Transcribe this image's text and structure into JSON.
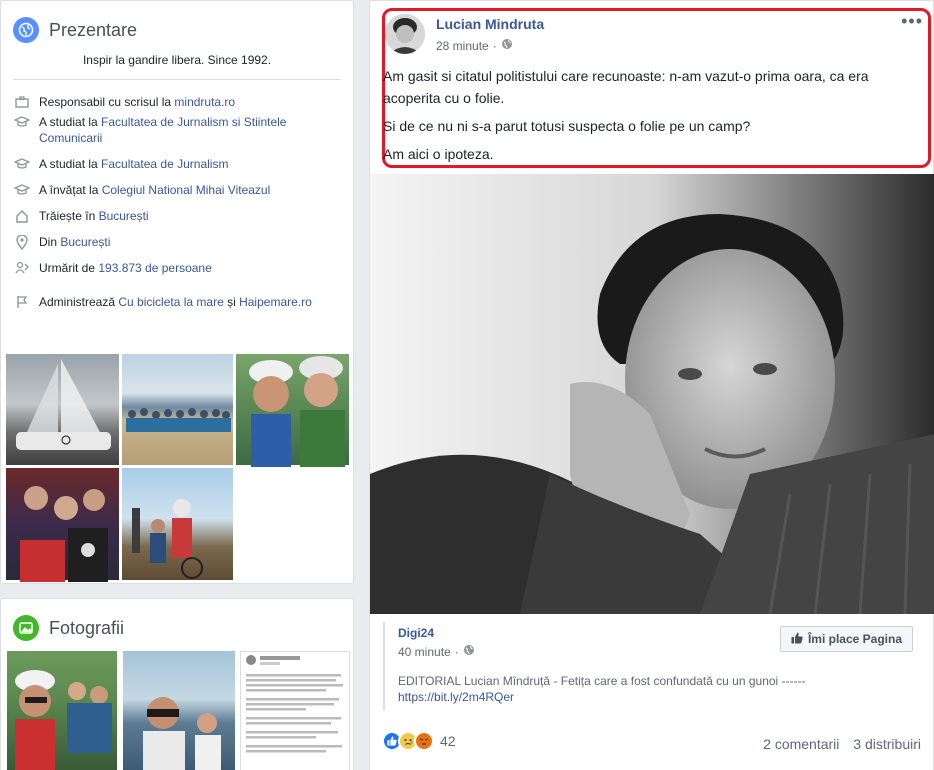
{
  "intro": {
    "title": "Prezentare",
    "bio": "Inspir la gandire libera. Since 1992.",
    "rows": [
      {
        "icon": "briefcase-icon",
        "pre": "Responsabil cu scrisul la ",
        "link": "mindruta.ro",
        "post": ""
      },
      {
        "icon": "graduation-cap-icon",
        "pre": "A studiat la ",
        "link": "Facultatea de Jurnalism si Stiintele Comunicarii",
        "post": ""
      },
      {
        "icon": "graduation-cap-icon",
        "pre": "A studiat la ",
        "link": "Facultatea de Jurnalism",
        "post": ""
      },
      {
        "icon": "graduation-cap-icon",
        "pre": "A învățat la ",
        "link": "Colegiul National Mihai Viteazul",
        "post": ""
      },
      {
        "icon": "home-icon",
        "pre": "Trăiește în ",
        "link": "București",
        "post": ""
      },
      {
        "icon": "location-pin-icon",
        "pre": "Din ",
        "link": "București",
        "post": ""
      },
      {
        "icon": "follow-icon",
        "pre": "Urmărit de ",
        "link": "193.873 de persoane",
        "post": ""
      },
      {
        "icon": "flag-icon",
        "pre": "Administrează ",
        "link": "Cu bicicleta la mare",
        "post": " și ",
        "link2": "Haipemare.ro"
      }
    ]
  },
  "photos_card": {
    "title": "Fotografii"
  },
  "post": {
    "author": "Lucian Mindruta",
    "time": "28 minute",
    "more": "•••",
    "paragraphs": [
      "Am gasit si citatul politistului care recunoaste: n-am vazut-o prima oara, ca era acoperita cu o folie.",
      "Si de ce nu ni s-a parut totusi suspecta o folie pe un camp?",
      "Am aici o ipoteza."
    ],
    "shared": {
      "page": "Digi24",
      "time": "40 minute",
      "like_page": "Îmi place Pagina",
      "text": "EDITORIAL Lucian Mîndruță - Fetița care a fost confundată cu un gunoi ------",
      "url": "https://bit.ly/2m4RQer"
    },
    "reactions_count": "42",
    "comments": "2 comentarii",
    "shares": "3 distribuiri"
  },
  "colors": {
    "link": "#385898",
    "highlight": "#e01a26",
    "intro_icon": "#5890ff",
    "photos_icon": "#42b72a"
  }
}
